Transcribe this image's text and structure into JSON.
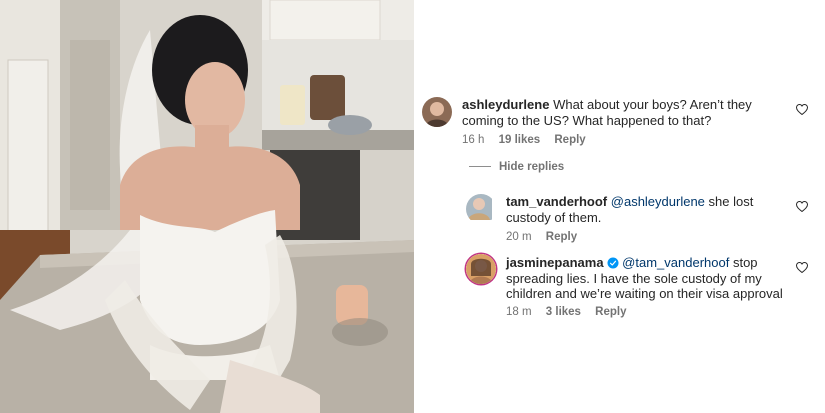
{
  "post": {
    "image_alt": "Photo of a woman in a white bridal outfit and veil sitting on a kitchen counter"
  },
  "comments": [
    {
      "username": "ashleydurlene",
      "text": "What about your boys? Aren’t they coming to the US? What happened to that?",
      "time": "16 h",
      "likes": "19 likes",
      "reply": "Reply",
      "avatar_color": "#8b6a55"
    }
  ],
  "hide_replies_label": "Hide replies",
  "replies": [
    {
      "username": "tam_vanderhoof",
      "mention": "@ashleydurlene",
      "text": "she lost custody of them.",
      "time": "20 m",
      "reply": "Reply",
      "avatar_color": "#a9b8c2"
    },
    {
      "username": "jasminepanama",
      "verified": true,
      "mention": "@tam_vanderhoof",
      "text": "stop spreading lies. I have the sole custody of my children and we’re waiting on their visa approval",
      "time": "18 m",
      "likes": "3 likes",
      "reply": "Reply",
      "avatar_color": "#d9a066"
    }
  ],
  "colors": {
    "mention": "#00376b",
    "meta": "#737373",
    "verified": "#0095f6"
  }
}
